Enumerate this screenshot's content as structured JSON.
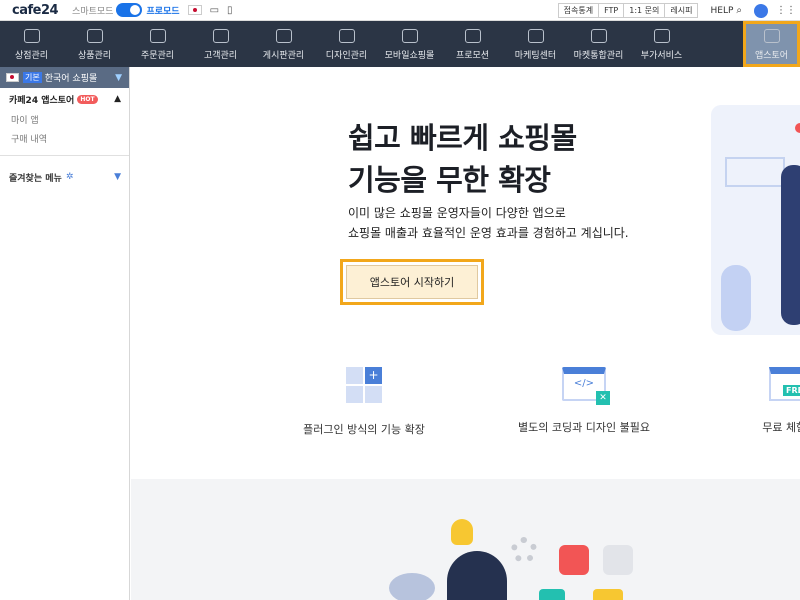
{
  "topbar": {
    "logo": "cafe24",
    "mode_smart": "스마트모드",
    "mode_pro": "프로모드",
    "buttons": [
      "접속통계",
      "FTP",
      "1:1 문의",
      "레시피"
    ],
    "help": "HELP"
  },
  "nav": {
    "items": [
      {
        "label": "상점관리",
        "icon": "home-icon"
      },
      {
        "label": "상품관리",
        "icon": "shirt-icon"
      },
      {
        "label": "주문관리",
        "icon": "cart-icon"
      },
      {
        "label": "고객관리",
        "icon": "users-icon"
      },
      {
        "label": "게시판관리",
        "icon": "board-icon"
      },
      {
        "label": "디자인관리",
        "icon": "palette-icon"
      },
      {
        "label": "모바일쇼핑몰",
        "icon": "mobile-icon"
      },
      {
        "label": "프로모션",
        "icon": "star-icon"
      },
      {
        "label": "마케팅센터",
        "icon": "monitor-icon"
      },
      {
        "label": "마켓통합관리",
        "icon": "network-icon"
      },
      {
        "label": "부가서비스",
        "icon": "folder-plus-icon"
      }
    ],
    "active": {
      "label": "앱스토어",
      "icon": "apps-grid-icon"
    }
  },
  "sidebar": {
    "shop_badge": "기본",
    "shop_name": "한국어 쇼핑몰",
    "section_title": "카페24 앱스토어",
    "hot_badge": "HOT",
    "sub_items": [
      "마이 앱",
      "구매 내역"
    ],
    "favorites": "즐겨찾는 메뉴"
  },
  "main": {
    "hero_title_line1": "쉽고 빠르게 쇼핑몰",
    "hero_title_line2": "기능을 무한 확장",
    "hero_desc_line1": "이미 많은 쇼핑몰 운영자들이 다양한 앱으로",
    "hero_desc_line2": "쇼핑몰 매출과 효율적인 운영 효과를 경험하고 계십니다.",
    "cta": "앱스토어 시작하기",
    "features": [
      {
        "label": "플러그인 방식의 기능 확장",
        "icon": "plugin-icon"
      },
      {
        "label": "별도의 코딩과 디자인 불필요",
        "icon": "code-icon"
      },
      {
        "label": "무료 체험 기",
        "icon": "free-icon",
        "tag": "FREE"
      }
    ]
  },
  "colors": {
    "nav_bg": "#2b3545",
    "active_tab": "#7f93ad",
    "highlight": "#f2a71b",
    "accent": "#1a73e8"
  }
}
